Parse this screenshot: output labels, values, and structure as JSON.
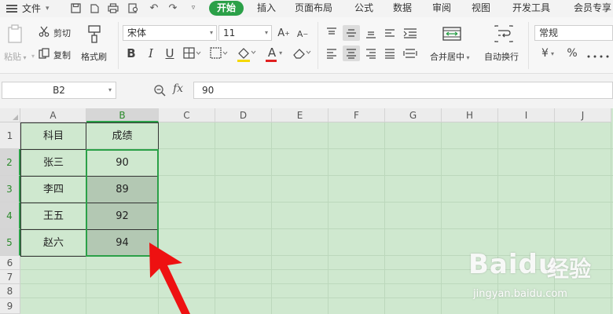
{
  "menubar": {
    "file_label": "文件",
    "tabs": [
      "开始",
      "插入",
      "页面布局",
      "公式",
      "数据",
      "审阅",
      "视图",
      "开发工具",
      "会员专享"
    ],
    "active_tab": "开始"
  },
  "ribbon": {
    "cut_label": "剪切",
    "copy_label": "复制",
    "paste_label": "粘贴",
    "format_painter_label": "格式刷",
    "font_name": "宋体",
    "font_size": "11",
    "merge_center_label": "合并居中",
    "wrap_text_label": "自动换行",
    "number_format": "常规",
    "bold": "B",
    "italic": "I",
    "underline": "U",
    "font_color_glyph": "A",
    "percent_glyph": "%",
    "currency_glyph": "¥",
    "font_color": "#e02020",
    "fill_color": "#f5d800"
  },
  "formula_bar": {
    "name_box": "B2",
    "formula_value": "90"
  },
  "sheet": {
    "columns": [
      "A",
      "B",
      "C",
      "D",
      "E",
      "F",
      "G",
      "H",
      "I",
      "J"
    ],
    "rows": [
      "1",
      "2",
      "3",
      "4",
      "5",
      "6",
      "7",
      "8",
      "9"
    ],
    "selected_column": "B",
    "selected_rows": [
      "2",
      "3",
      "4",
      "5"
    ],
    "headers": [
      "科目",
      "成绩"
    ],
    "data": [
      {
        "subject": "张三",
        "score": "90"
      },
      {
        "subject": "李四",
        "score": "89"
      },
      {
        "subject": "王五",
        "score": "92"
      },
      {
        "subject": "赵六",
        "score": "94"
      }
    ],
    "accent_color": "#2ba048",
    "background_color": "#cfe8cf"
  },
  "watermark": {
    "logo": "Baidu",
    "logo_cn": "经验",
    "url": "jingyan.baidu.com"
  }
}
